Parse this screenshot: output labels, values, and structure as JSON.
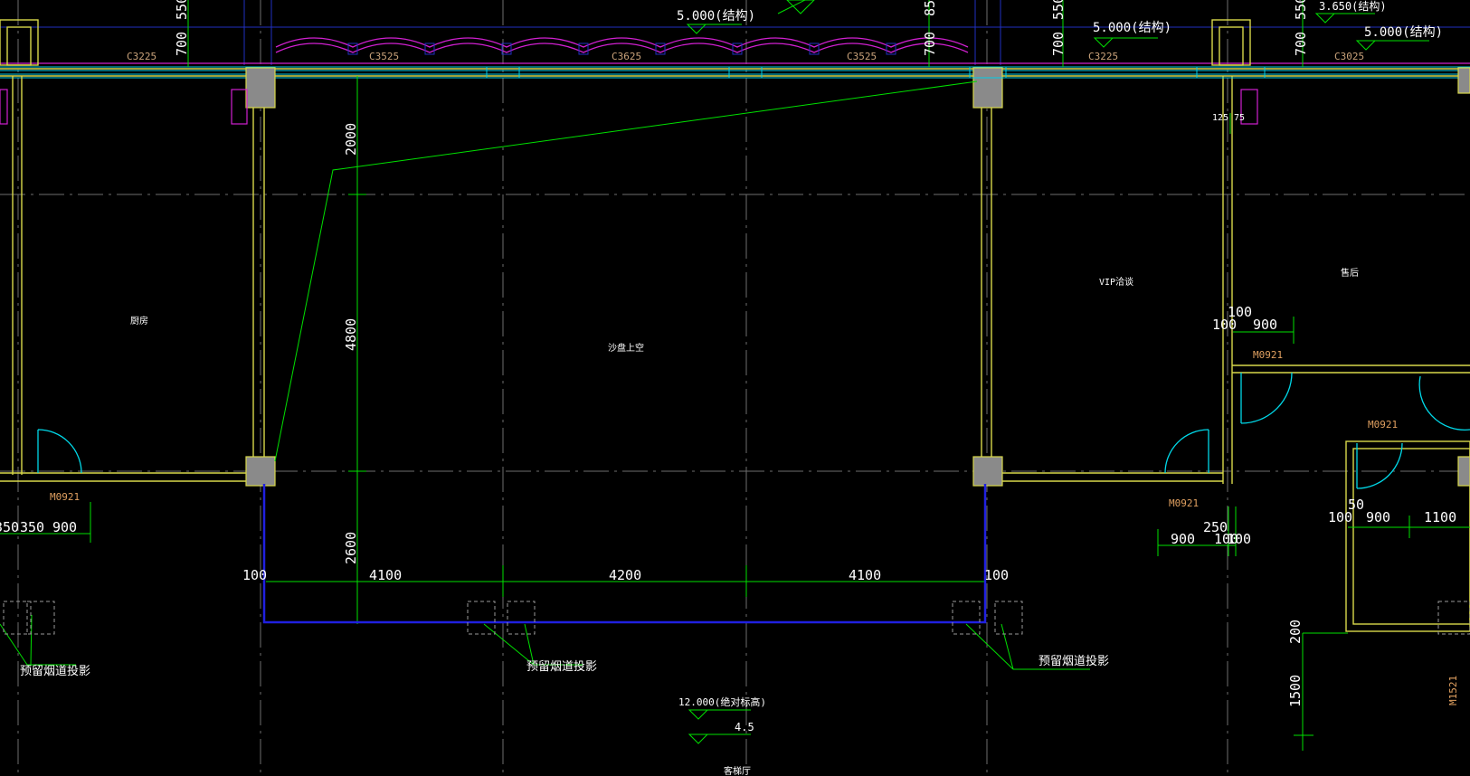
{
  "colors": {
    "background": "#000000",
    "wall": "#d8d84a",
    "column": "#8a8a8a",
    "axis": "#7a7a7a",
    "dimension": "#00e000",
    "window": "#00cfe8",
    "roof": "#d020d0",
    "outline": "#2020e0",
    "door_swing": "#00d8e8",
    "grid_blue": "#2030c0"
  },
  "elevation_labels": [
    "5.000(结构)",
    "5.000(结构)",
    "5.000(结构)",
    "3.650(结构)",
    "12.000(绝对标高)",
    "4.5"
  ],
  "window_tags": [
    "C3225",
    "C3525",
    "C3625",
    "C3525",
    "C3225",
    "C3025"
  ],
  "door_tags": [
    "M0921",
    "M0921",
    "M0921",
    "M0921",
    "M1521"
  ],
  "room_labels": [
    "厨房",
    "沙盘上空",
    "VIP洽谈",
    "售后"
  ],
  "notes": [
    "预留烟道投影",
    "预留烟道投影",
    "预留烟道投影"
  ],
  "top_dims": [
    "700",
    "550",
    "700",
    "85",
    "700",
    "550",
    "700",
    "550"
  ],
  "vertical_dims": [
    "2000",
    "4800",
    "2600",
    "200",
    "1500"
  ],
  "bottom_dims": [
    "100",
    "4100",
    "4200",
    "4100",
    "100"
  ],
  "left_dims": [
    "350",
    "350",
    "900"
  ],
  "right_dims": [
    "100",
    "100",
    "900",
    "125",
    "75",
    "250",
    "900",
    "100",
    "100",
    "50",
    "100",
    "900",
    "1100"
  ],
  "bottom_cut": "客梯厅"
}
